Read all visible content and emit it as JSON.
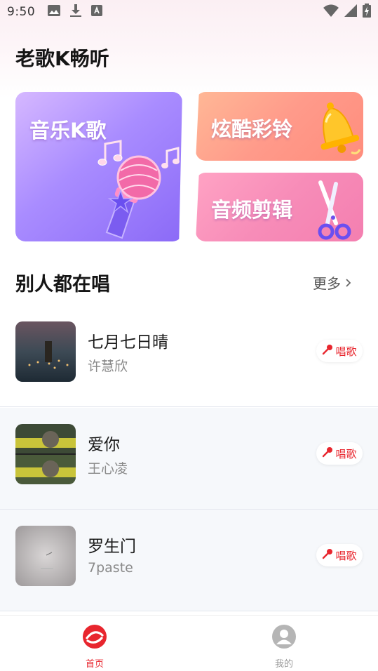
{
  "status_bar": {
    "time": "9:50",
    "left_icons": [
      "image-icon",
      "download-icon",
      "a-text-icon"
    ],
    "right_icons": [
      "wifi-icon",
      "signal-icon",
      "battery-charging-icon"
    ]
  },
  "app": {
    "title": "老歌K畅听"
  },
  "feature_cards": {
    "karaoke": "音乐K歌",
    "ringtone": "炫酷彩铃",
    "audio_edit": "音频剪辑"
  },
  "section": {
    "title": "别人都在唱",
    "more_label": "更多"
  },
  "songs": [
    {
      "title": "七月七日晴",
      "artist": "许慧欣",
      "action": "唱歌"
    },
    {
      "title": "爱你",
      "artist": "王心凌",
      "action": "唱歌"
    },
    {
      "title": "罗生门",
      "artist": "7paste",
      "action": "唱歌"
    }
  ],
  "bottom_nav": {
    "home_label": "首页",
    "mine_label": "我的"
  },
  "colors": {
    "accent": "#e8262e",
    "karaoke_card": "#a98cff",
    "ringtone_card": "#ff9a8a",
    "audio_card": "#f78cb8"
  }
}
